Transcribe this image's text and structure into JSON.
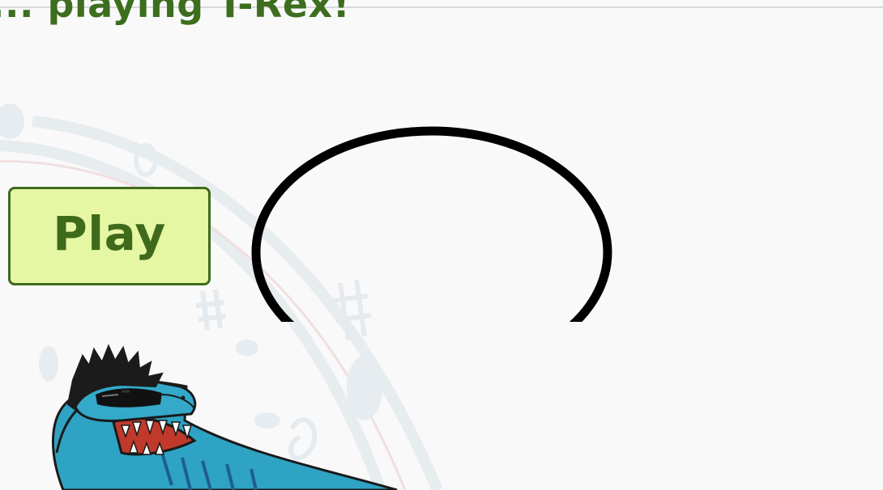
{
  "header": {
    "text": "... playing T-Rex!"
  },
  "play_button": {
    "label": "Play"
  },
  "colors": {
    "accent_green": "#3f6a1c",
    "button_fill": "#e5f7a3",
    "ring": "#000000",
    "dino_teal": "#2fa3c4"
  },
  "icons": {
    "background": "music-notes-swirl",
    "character": "t-rex-sunglasses"
  }
}
